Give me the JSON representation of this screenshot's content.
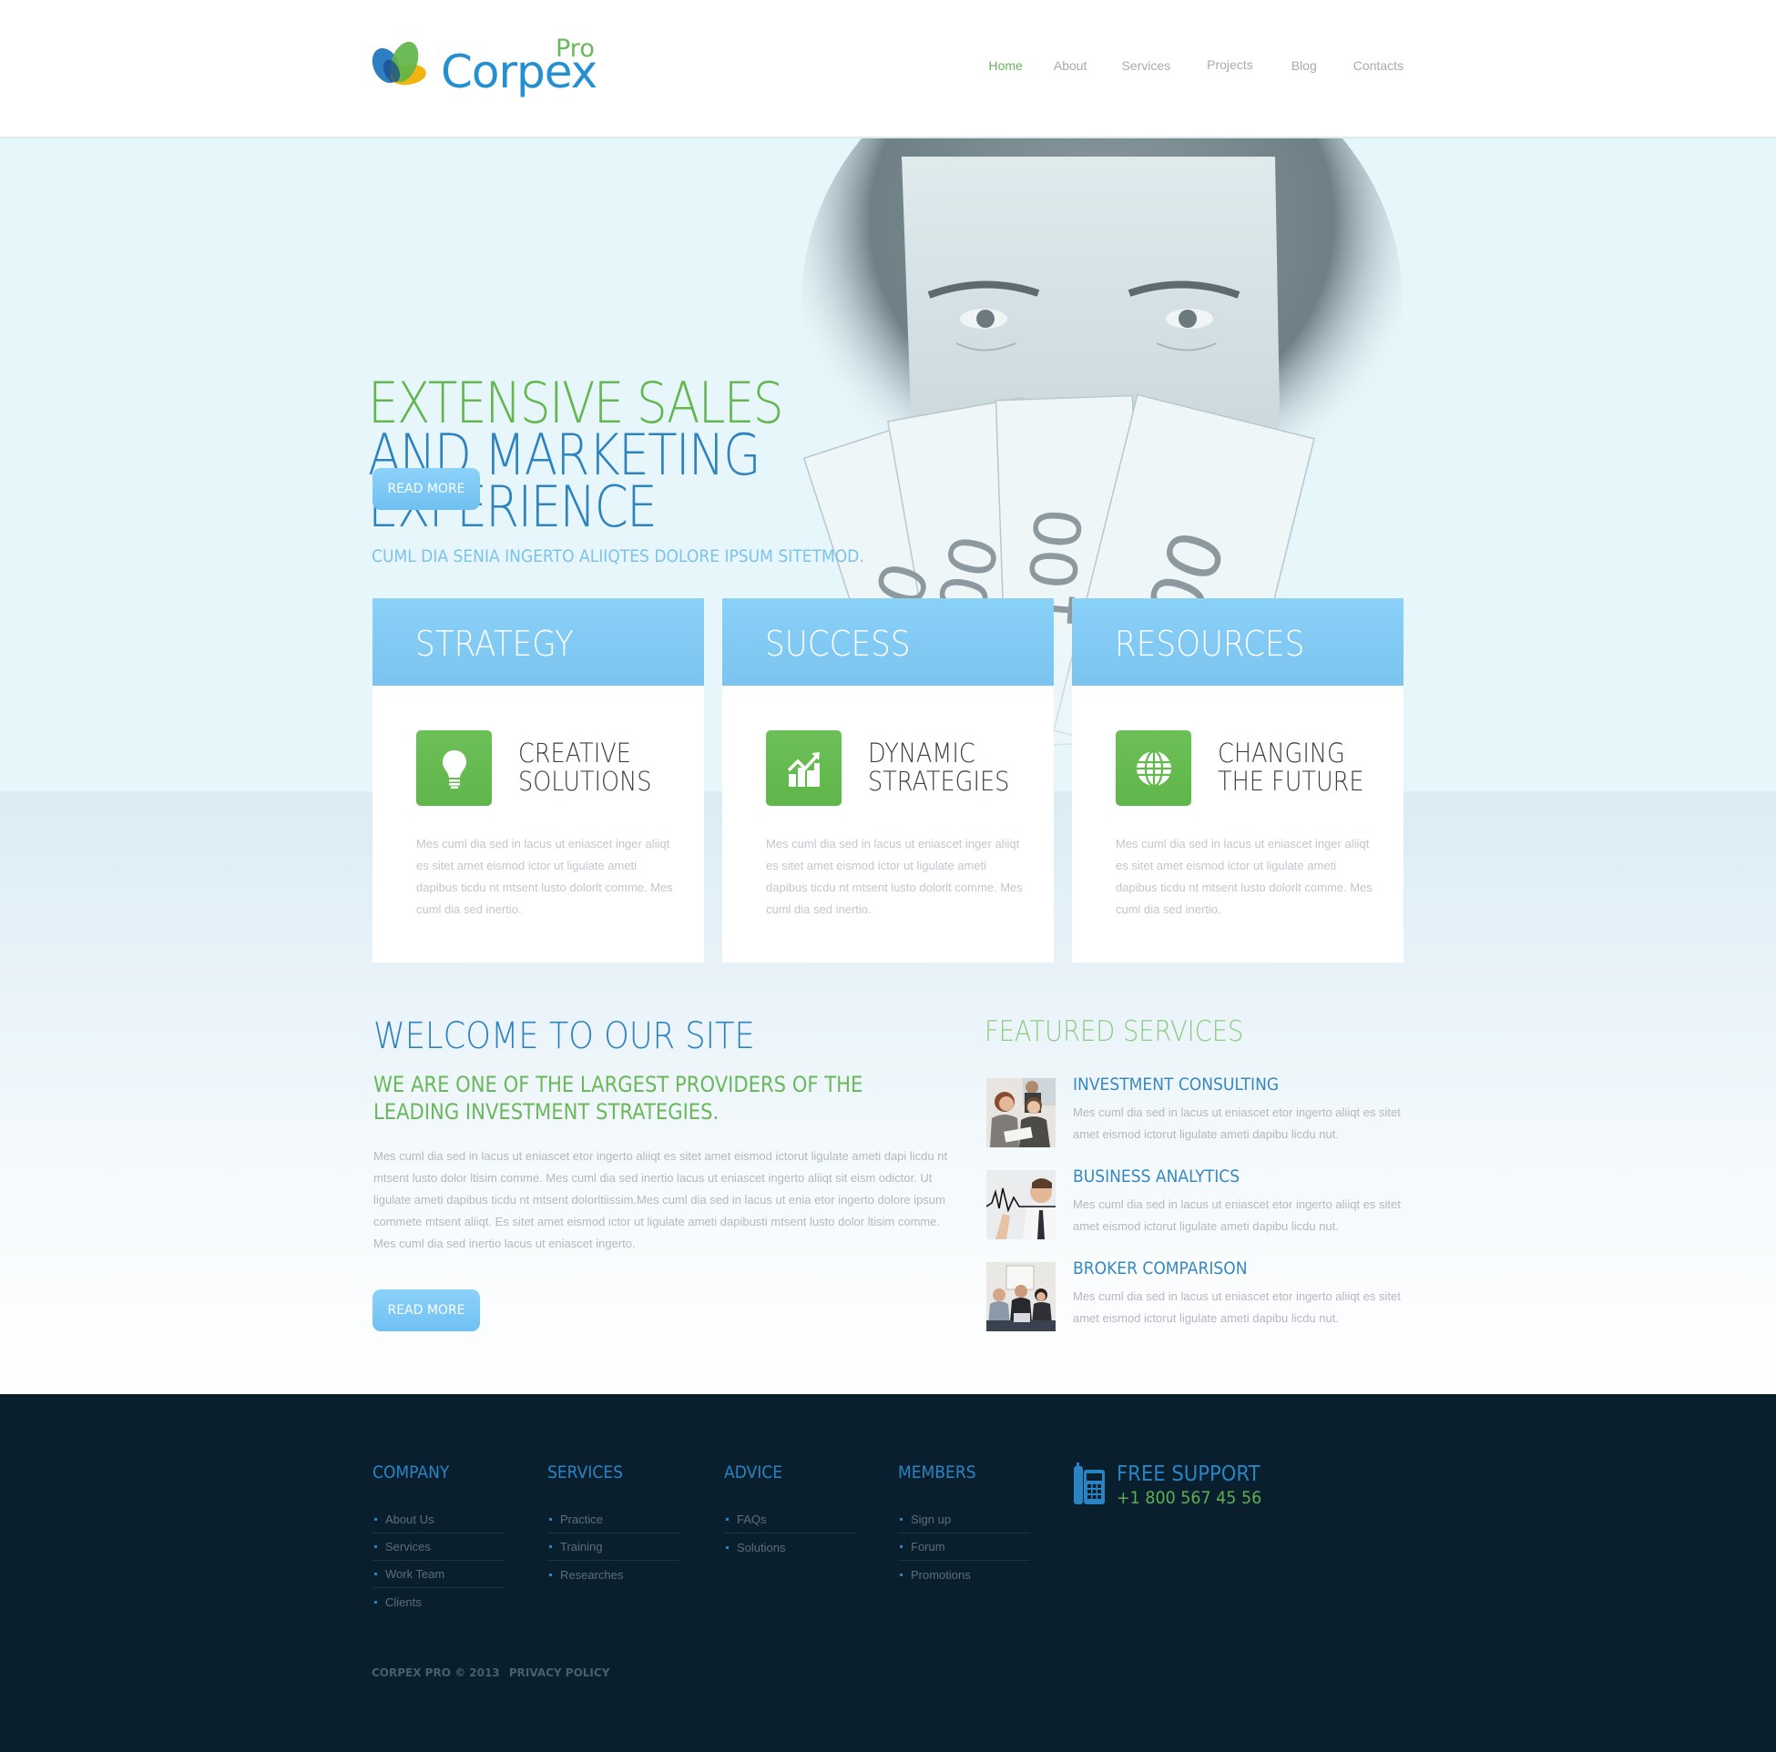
{
  "brand": {
    "name": "Corpex",
    "suffix": "Pro"
  },
  "nav": {
    "items": [
      {
        "label": "Home",
        "active": true
      },
      {
        "label": "About",
        "active": false
      },
      {
        "label": "Services",
        "active": false
      },
      {
        "label": "Projects",
        "active": false
      },
      {
        "label": "Blog",
        "active": false
      },
      {
        "label": "Contacts",
        "active": false
      }
    ]
  },
  "hero": {
    "title_line1": "EXTENSIVE SALES",
    "title_line2": "AND MARKETING",
    "title_line3": "EXPERIENCE",
    "subtitle": "CUML DIA SENIA INGERTO ALIIQTES DOLORE IPSUM SITETMOD.",
    "button_label": "READ MORE",
    "image": "man-holding-euro-banknotes-photo"
  },
  "cards": [
    {
      "title": "STRATEGY",
      "icon": "lightbulb-icon",
      "sub1": "CREATIVE",
      "sub2": "SOLUTIONS",
      "text": "Mes cuml dia sed in lacus ut eniascet inger aliiqt es sitet amet eismod ictor ut ligulate ameti dapibus ticdu nt mtsent lusto dolorlt comme. Mes cuml dia sed inertio."
    },
    {
      "title": "SUCCESS",
      "icon": "growth-chart-icon",
      "sub1": "DYNAMIC",
      "sub2": "STRATEGIES",
      "text": "Mes cuml dia sed in lacus ut eniascet inger aliiqt es sitet amet eismod ictor ut ligulate ameti dapibus ticdu nt mtsent lusto dolorlt comme. Mes cuml dia sed inertio."
    },
    {
      "title": "RESOURCES",
      "icon": "globe-icon",
      "sub1": "CHANGING",
      "sub2": "THE FUTURE",
      "text": "Mes cuml dia sed in lacus ut eniascet inger aliiqt es sitet amet eismod ictor ut ligulate ameti dapibus ticdu nt mtsent lusto dolorlt comme. Mes cuml dia sed inertio."
    }
  ],
  "welcome": {
    "title": "WELCOME TO OUR SITE",
    "sub_line1": "WE ARE ONE OF THE LARGEST PROVIDERS OF THE",
    "sub_line2": "LEADING INVESTMENT STRATEGIES.",
    "text": "Mes cuml dia sed in lacus ut eniascet etor ingerto aliiqt es sitet amet eismod ictorut ligulate ameti dapi licdu nt mtsent lusto dolor ltisim comme. Mes cuml dia sed inertio lacus ut eniascet ingerto aliiqt sit eism odictor. Ut ligulate ameti dapibus ticdu nt mtsent dolorltiissim.Mes cuml dia sed in lacus ut enia etor ingerto dolore ipsum commete mtsent aliiqt. Es sitet amet eismod ictor ut ligulate ameti dapibusti mtsent lusto dolor ltisim comme. Mes cuml dia sed inertio lacus ut eniascet ingerto.",
    "button_label": "READ MORE"
  },
  "featured": {
    "title": "FEATURED SERVICES",
    "items": [
      {
        "name": "INVESTMENT CONSULTING",
        "text": "Mes cuml dia sed in lacus ut eniascet etor ingerto aliiqt es sitet amet eismod ictorut ligulate ameti dapibu licdu nut.",
        "thumb": "business-team-photo"
      },
      {
        "name": "BUSINESS ANALYTICS",
        "text": "Mes cuml dia sed in lacus ut eniascet etor ingerto aliiqt es sitet amet eismod ictorut ligulate ameti dapibu licdu nut.",
        "thumb": "man-drawing-chart-photo"
      },
      {
        "name": "BROKER COMPARISON",
        "text": "Mes cuml dia sed in lacus ut eniascet etor ingerto aliiqt es sitet amet eismod ictorut ligulate ameti dapibu licdu nut.",
        "thumb": "business-meeting-photo"
      }
    ]
  },
  "footer": {
    "columns": [
      {
        "title": "COMPANY",
        "links": [
          "About Us",
          "Services",
          "Work Team",
          "Clients"
        ]
      },
      {
        "title": "SERVICES",
        "links": [
          "Practice",
          "Training",
          "Researches"
        ]
      },
      {
        "title": "ADVICE",
        "links": [
          "FAQs",
          "Solutions"
        ]
      },
      {
        "title": "MEMBERS",
        "links": [
          "Sign up",
          "Forum",
          "Promotions"
        ]
      }
    ],
    "support": {
      "title": "FREE SUPPORT",
      "phone": "+1 800 567 45 56",
      "icon": "phone-icon"
    },
    "copyright": "CORPEX PRO © 2013",
    "privacy_label": "PRIVACY POLICY"
  },
  "colors": {
    "brand_blue": "#2490cf",
    "brand_green": "#6ab85c",
    "accent_light_blue": "#8ad1f8",
    "footer_bg": "#0a1f2e"
  }
}
